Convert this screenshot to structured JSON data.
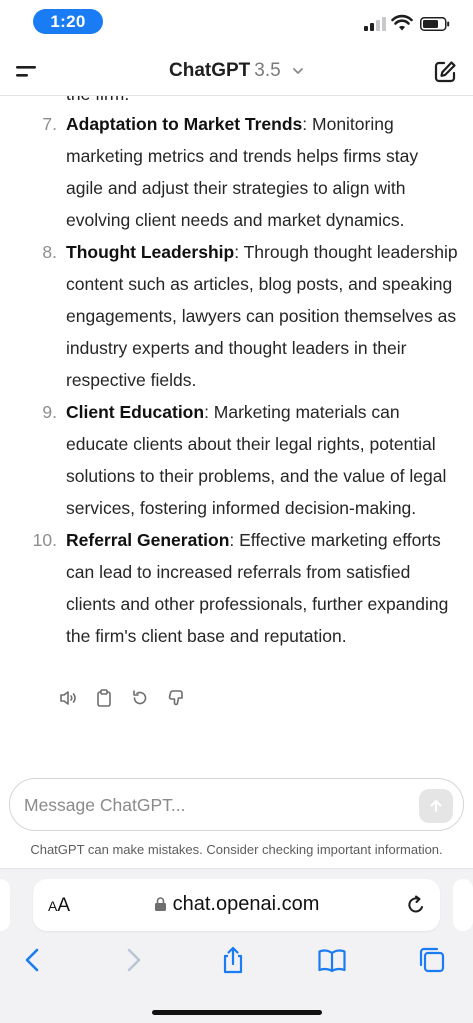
{
  "status_bar": {
    "time": "1:20"
  },
  "header": {
    "title": "ChatGPT",
    "version": "3.5"
  },
  "chat": {
    "cut_text": "the firm.",
    "items": [
      {
        "number": "7.",
        "bold": "Adaptation to Market Trends",
        "text": ": Monitoring marketing metrics and trends helps firms stay agile and adjust their strategies to align with evolving client needs and market dynamics."
      },
      {
        "number": "8.",
        "bold": "Thought Leadership",
        "text": ": Through thought leadership content such as articles, blog posts, and speaking engagements, lawyers can position themselves as industry experts and thought leaders in their respective fields."
      },
      {
        "number": "9.",
        "bold": "Client Education",
        "text": ": Marketing materials can educate clients about their legal rights, potential solutions to their problems, and the value of legal services, fostering informed decision-making."
      },
      {
        "number": "10.",
        "bold": "Referral Generation",
        "text": ": Effective marketing efforts can lead to increased referrals from satisfied clients and other professionals, further expanding the firm's client base and reputation."
      }
    ],
    "actions": [
      "read-aloud-icon",
      "copy-icon",
      "regenerate-icon",
      "thumbs-down-icon"
    ]
  },
  "composer": {
    "placeholder": "Message ChatGPT...",
    "disclaimer": "ChatGPT can make mistakes. Consider checking important information."
  },
  "browser": {
    "aa_label_big": "A",
    "aa_label_small": "A",
    "url": "chat.openai.com"
  },
  "colors": {
    "accent": "#1a7cf4",
    "text": "#1f1f1f",
    "muted": "#8e8e8e"
  }
}
